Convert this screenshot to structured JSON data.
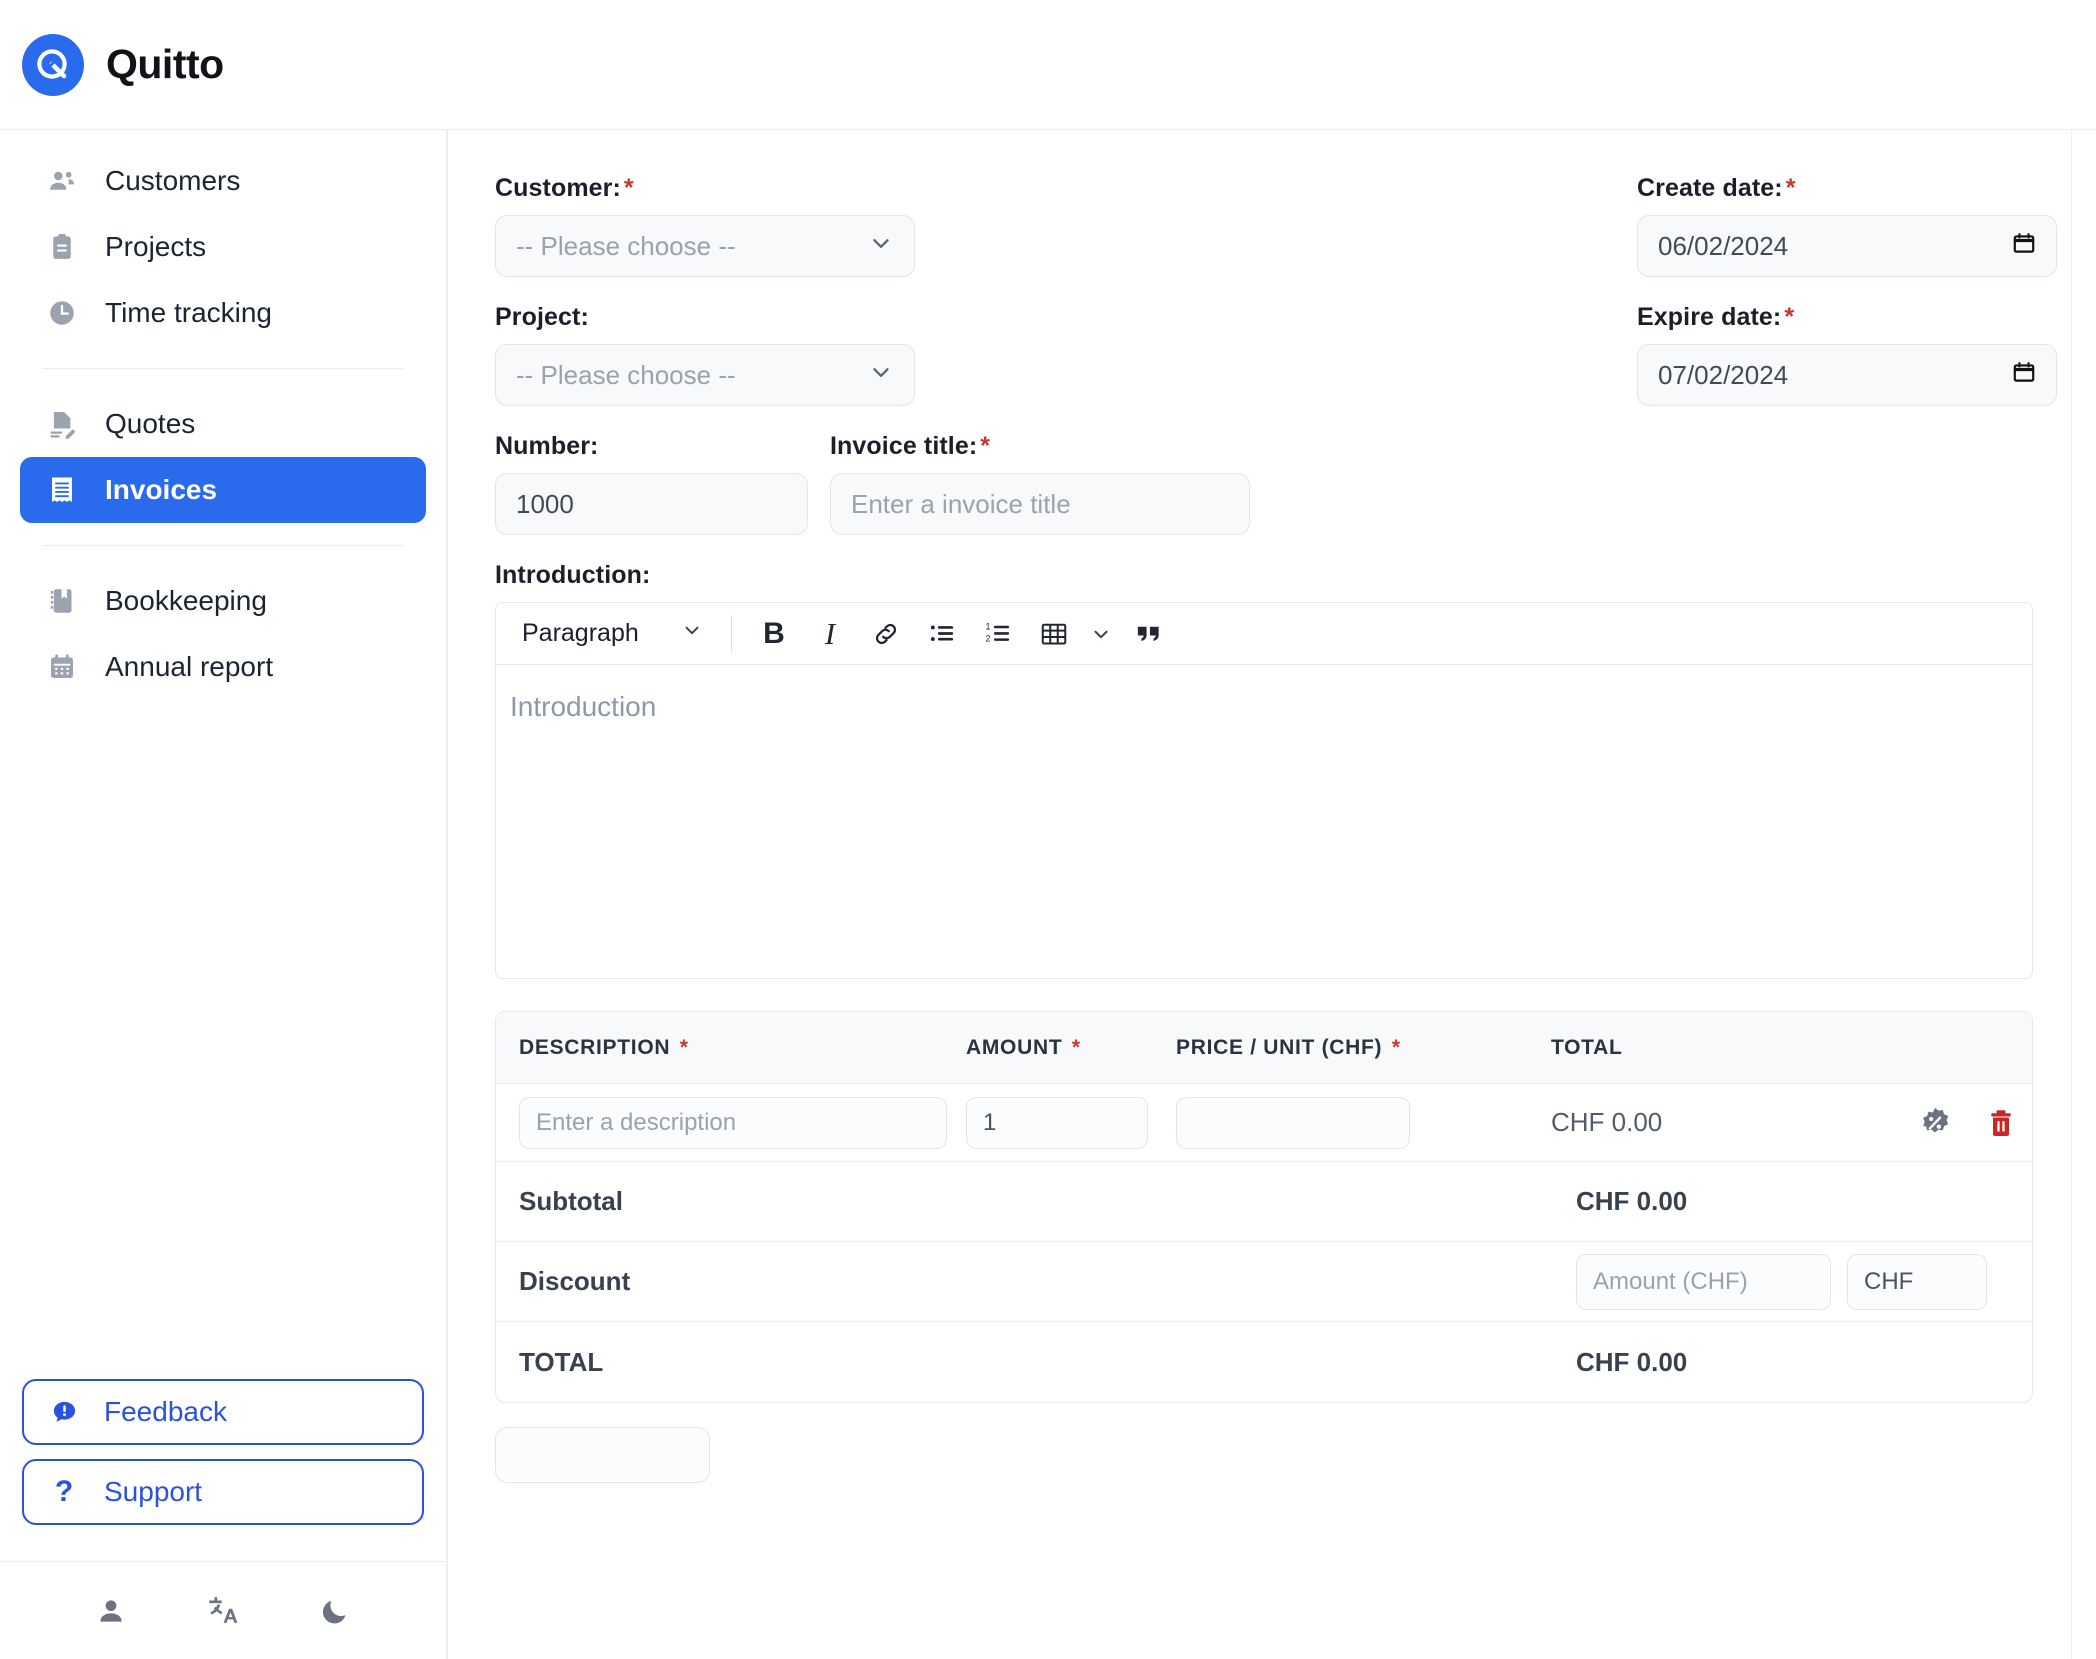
{
  "app": {
    "name": "Quitto",
    "logo_icon": "quitto-logo-icon",
    "brand_color": "#2a6bee",
    "required_color": "#c0392b"
  },
  "sidebar": {
    "groups": [
      {
        "items": [
          {
            "label": "Customers",
            "icon": "people-icon",
            "active": false
          },
          {
            "label": "Projects",
            "icon": "clipboard-icon",
            "active": false
          },
          {
            "label": "Time tracking",
            "icon": "clock-icon",
            "active": false
          }
        ]
      },
      {
        "items": [
          {
            "label": "Quotes",
            "icon": "document-edit-icon",
            "active": false
          },
          {
            "label": "Invoices",
            "icon": "receipt-icon",
            "active": true
          }
        ]
      },
      {
        "items": [
          {
            "label": "Bookkeeping",
            "icon": "book-icon",
            "active": false
          },
          {
            "label": "Annual report",
            "icon": "calendar-icon",
            "active": false
          }
        ]
      }
    ],
    "actions": [
      {
        "label": "Feedback",
        "icon": "feedback-bubble-icon"
      },
      {
        "label": "Support",
        "icon": "question-mark-icon"
      }
    ],
    "footer_icons": [
      {
        "name": "account-icon"
      },
      {
        "name": "translate-icon"
      },
      {
        "name": "dark-mode-moon-icon"
      }
    ]
  },
  "form": {
    "customer": {
      "label": "Customer:",
      "required": "*",
      "value": "-- Please choose --"
    },
    "project": {
      "label": "Project:",
      "required": "",
      "value": "-- Please choose --"
    },
    "create_date": {
      "label": "Create date:",
      "required": "*",
      "value": "06/02/2024"
    },
    "expire_date": {
      "label": "Expire date:",
      "required": "*",
      "value": "07/02/2024"
    },
    "number": {
      "label": "Number:",
      "required": "",
      "value": "1000"
    },
    "invoice_title": {
      "label": "Invoice title:",
      "required": "*",
      "value": "",
      "placeholder": "Enter a invoice title"
    },
    "introduction": {
      "label": "Introduction:",
      "placeholder": "Introduction",
      "toolbar": {
        "block_format": "Paragraph",
        "buttons": [
          {
            "name": "bold-icon",
            "glyph": "B"
          },
          {
            "name": "italic-icon",
            "glyph": "I"
          },
          {
            "name": "link-icon",
            "glyph": "link"
          },
          {
            "name": "bulleted-list-icon",
            "glyph": "ul"
          },
          {
            "name": "numbered-list-icon",
            "glyph": "ol"
          },
          {
            "name": "table-icon",
            "glyph": "table"
          },
          {
            "name": "table-dropdown-icon",
            "glyph": "chevron"
          },
          {
            "name": "blockquote-icon",
            "glyph": "quote"
          }
        ]
      }
    }
  },
  "items_table": {
    "headers": [
      {
        "label": "DESCRIPTION",
        "required": "*"
      },
      {
        "label": "AMOUNT",
        "required": "*"
      },
      {
        "label": "PRICE / UNIT (CHF)",
        "required": "*"
      },
      {
        "label": "TOTAL",
        "required": ""
      }
    ],
    "rows": [
      {
        "description": "",
        "description_placeholder": "Enter a description",
        "amount": "1",
        "price": "",
        "total": "CHF 0.00",
        "discount_icon": "percent-badge-icon",
        "delete_icon": "trash-icon"
      }
    ],
    "summary": [
      {
        "label": "Subtotal",
        "value": "CHF 0.00",
        "type": "value"
      },
      {
        "label": "Discount",
        "type": "input",
        "amount_placeholder": "Amount (CHF)",
        "amount_value": "",
        "currency_value": "CHF"
      },
      {
        "label": "TOTAL",
        "value": "CHF 0.00",
        "type": "value"
      }
    ]
  }
}
